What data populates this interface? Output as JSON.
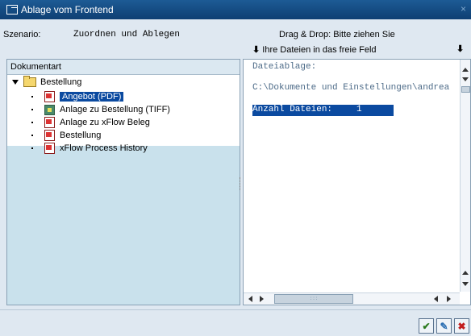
{
  "window": {
    "title": "Ablage vom Frontend",
    "close_symbol": "×"
  },
  "scenario": {
    "label": "Szenario:",
    "value": "Zuordnen und Ablegen"
  },
  "dragdrop": {
    "hint": "Drag & Drop: Bitte ziehen Sie",
    "arrow": "⬇",
    "subhint": "Ihre Dateien in das freie Feld"
  },
  "tree": {
    "header": "Dokumentart",
    "root": "Bestellung",
    "items": [
      {
        "label": "Angebot (PDF)",
        "icon": "pdf-doc-icon",
        "selected": true
      },
      {
        "label": "Anlage zu Bestellung (TIFF)",
        "icon": "image-doc-icon",
        "selected": false
      },
      {
        "label": "Anlage zu xFlow Beleg",
        "icon": "pdf-doc-icon",
        "selected": false
      },
      {
        "label": "Bestellung",
        "icon": "pdf-doc-icon",
        "selected": false
      },
      {
        "label": "xFlow Process History",
        "icon": "pdf-doc-icon",
        "selected": false
      }
    ]
  },
  "filepane": {
    "line1": "Dateiablage:",
    "line2": "C:\\Dokumente und Einstellungen\\andrea",
    "count_label": "Anzahl Dateien:",
    "count_value": "1"
  },
  "buttons": {
    "ok": "✔",
    "action": "✎",
    "cancel": "✖"
  },
  "colors": {
    "title_bar": "#1d5b95",
    "selection": "#0b4aa0",
    "tree_panel": "#c9e1ec"
  }
}
